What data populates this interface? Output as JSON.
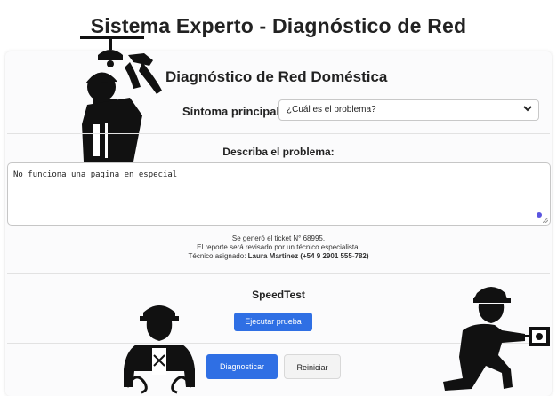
{
  "header": {
    "title": "Sistema Experto - Diagnóstico de Red"
  },
  "card": {
    "title": "Diagnóstico de Red Doméstica"
  },
  "symptom": {
    "label": "Síntoma principal",
    "selected": "¿Cuál es el problema?"
  },
  "description": {
    "label": "Describa el problema:",
    "value": "No funciona una pagina en especial"
  },
  "ticket": {
    "line1": "Se generó el ticket N° 68995.",
    "line2": "El reporte será revisado por un técnico especialista.",
    "line3_prefix": "Técnico asignado:",
    "line3_value": "Laura Martinez (+54 9 2901 555-782)"
  },
  "speedtest": {
    "label": "SpeedTest",
    "run_button": "Ejecutar prueba"
  },
  "actions": {
    "diagnose": "Diagnosticar",
    "reset": "Reiniciar"
  },
  "colors": {
    "primary": "#2f6fe4",
    "grammar_dot": "#5b55e0"
  },
  "icons": [
    "technician-ceiling-icon",
    "technician-cables-icon",
    "technician-socket-icon",
    "chevron-down-icon"
  ]
}
